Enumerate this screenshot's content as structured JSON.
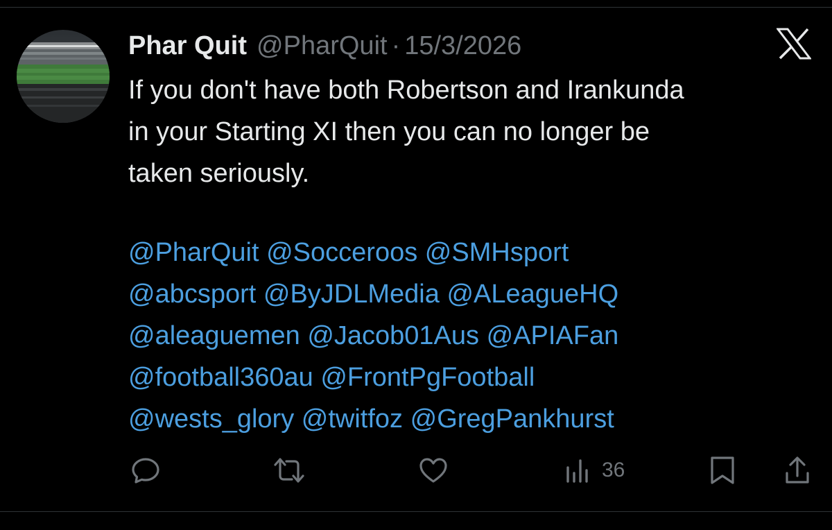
{
  "tweet": {
    "display_name": "Phar Quit",
    "handle": "@PharQuit",
    "separator": "·",
    "date": "15/3/2026",
    "text_lines": [
      "If you don't have both Robertson and Irankunda",
      "in your Starting XI then you can no longer be",
      "taken seriously."
    ],
    "mention_lines": [
      [
        "@PharQuit",
        "@Socceroos",
        "@SMHsport"
      ],
      [
        "@abcsport",
        "@ByJDLMedia",
        "@ALeagueHQ"
      ],
      [
        "@aleaguemen",
        "@Jacob01Aus",
        "@APIAFan"
      ],
      [
        "@football360au",
        "@FrontPgFootball"
      ],
      [
        "@wests_glory",
        "@twitfoz",
        "@GregPankhurst"
      ]
    ]
  },
  "actions": {
    "views_count": "36"
  },
  "icons": {
    "brand": "x-logo-icon",
    "reply": "reply-icon",
    "retweet": "retweet-icon",
    "like": "heart-icon",
    "views": "views-icon",
    "bookmark": "bookmark-icon",
    "share": "share-icon"
  },
  "colors": {
    "background": "#000000",
    "text": "#e7e9ea",
    "secondary": "#71767b",
    "link": "#4c9fe0",
    "border": "#2f3336"
  }
}
